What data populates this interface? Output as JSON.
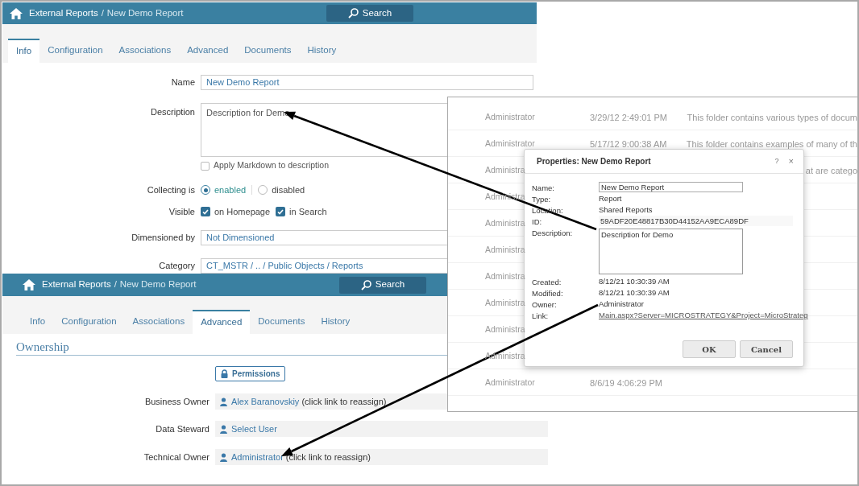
{
  "info_panel": {
    "header": {
      "root": "External Reports",
      "separator": "/",
      "current": "New Demo Report",
      "search": "Search"
    },
    "tabs": [
      {
        "label": "Info",
        "selected": true
      },
      {
        "label": "Configuration",
        "selected": false
      },
      {
        "label": "Associations",
        "selected": false
      },
      {
        "label": "Advanced",
        "selected": false
      },
      {
        "label": "Documents",
        "selected": false
      },
      {
        "label": "History",
        "selected": false
      }
    ],
    "name": {
      "label": "Name",
      "value": "New Demo Report"
    },
    "description": {
      "label": "Description",
      "value": "Description for Demo"
    },
    "markdown": {
      "label": "Apply Markdown to description",
      "checked": false
    },
    "collecting": {
      "label": "Collecting is",
      "options": [
        {
          "label": "enabled",
          "selected": true
        },
        {
          "label": "disabled",
          "selected": false
        }
      ]
    },
    "visible": {
      "label": "Visible",
      "options": [
        {
          "label": "on Homepage",
          "checked": true
        },
        {
          "label": "in Search",
          "checked": true
        }
      ]
    },
    "dimensioned_by": {
      "label": "Dimensioned by",
      "value": "Not Dimensioned"
    },
    "category": {
      "label": "Category",
      "value": "CT_MSTR / .. / Public Objects / Reports"
    }
  },
  "advanced_panel": {
    "header": {
      "root": "External Reports",
      "separator": "/",
      "current": "New Demo Report",
      "search": "Search"
    },
    "tabs": [
      {
        "label": "Info",
        "selected": false
      },
      {
        "label": "Configuration",
        "selected": false
      },
      {
        "label": "Associations",
        "selected": false
      },
      {
        "label": "Advanced",
        "selected": true
      },
      {
        "label": "Documents",
        "selected": false
      },
      {
        "label": "History",
        "selected": false
      }
    ],
    "section": "Ownership",
    "permissions": "Permissions",
    "owners": [
      {
        "label": "Business Owner",
        "user": "Alex Baranovskiy",
        "note": "(click link to reassign)"
      },
      {
        "label": "Data Steward",
        "user": "Select User"
      },
      {
        "label": "Technical Owner",
        "user": "Administrator",
        "note": "(click link to reassign)"
      }
    ]
  },
  "folder_list": {
    "rows": [
      {
        "column_1": "Administrator",
        "column_2": "3/29/12 2:49:01 PM",
        "column_3": "This folder contains various types of docum"
      },
      {
        "column_1": "Administrator",
        "column_2": "5/17/12 9:00:38 AM",
        "column_3": "This folder contains examples of many of th"
      },
      {
        "column_1": "Administra",
        "column_3": "at are catego"
      },
      {
        "column_1": "Administra"
      },
      {
        "column_1": "Administra"
      },
      {
        "column_1": "Administra"
      },
      {
        "column_1": "Administra"
      },
      {
        "column_1": "Administra"
      },
      {
        "column_1": "Administra"
      },
      {
        "column_1": "Administra"
      },
      {
        "column_1": "Administrator",
        "column_2": "8/6/19 4:06:29 PM"
      }
    ]
  },
  "properties_dialog": {
    "title": "Properties: New Demo Report",
    "help": "?",
    "close": "×",
    "fields": [
      {
        "kind": "input",
        "label": "Name:",
        "value": "New Demo Report"
      },
      {
        "kind": "text",
        "label": "Type:",
        "value": "Report"
      },
      {
        "kind": "text",
        "label": "Location:",
        "value": "Shared Reports"
      },
      {
        "kind": "readonly",
        "label": "ID:",
        "value": "59ADF20E48817B30D44152AA9ECA89DF"
      },
      {
        "kind": "textarea",
        "label": "Description:",
        "value": "Description for Demo"
      },
      {
        "kind": "text",
        "label": "Created:",
        "value": "8/12/21 10:30:39 AM"
      },
      {
        "kind": "text",
        "label": "Modified:",
        "value": "8/12/21 10:30:39 AM"
      },
      {
        "kind": "text",
        "label": "Owner:",
        "value": "Administrator"
      },
      {
        "kind": "link",
        "label": "Link:",
        "value": "Main.aspx?Server=MICROSTRATEGY&Project=MicroStrateg"
      }
    ],
    "buttons": [
      "OK",
      "Cancel"
    ]
  }
}
